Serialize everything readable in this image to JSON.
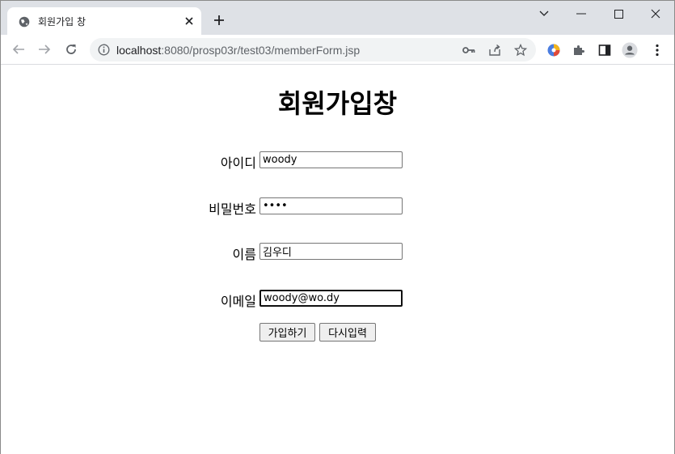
{
  "browser": {
    "tab_title": "회원가입 창",
    "url_host": "localhost",
    "url_rest": ":8080/prosp03r/test03/memberForm.jsp"
  },
  "page": {
    "title": "회원가입창",
    "fields": {
      "id": {
        "label": "아이디",
        "value": "woody"
      },
      "password": {
        "label": "비밀번호",
        "value": "••••"
      },
      "name": {
        "label": "이름",
        "value": "김우디"
      },
      "email": {
        "label": "이메일",
        "value": "woody@wo.dy"
      }
    },
    "buttons": {
      "submit": "가입하기",
      "reset": "다시입력"
    }
  },
  "colors": {
    "tabstrip": "#dee1e6",
    "omnibox": "#f1f3f4"
  }
}
